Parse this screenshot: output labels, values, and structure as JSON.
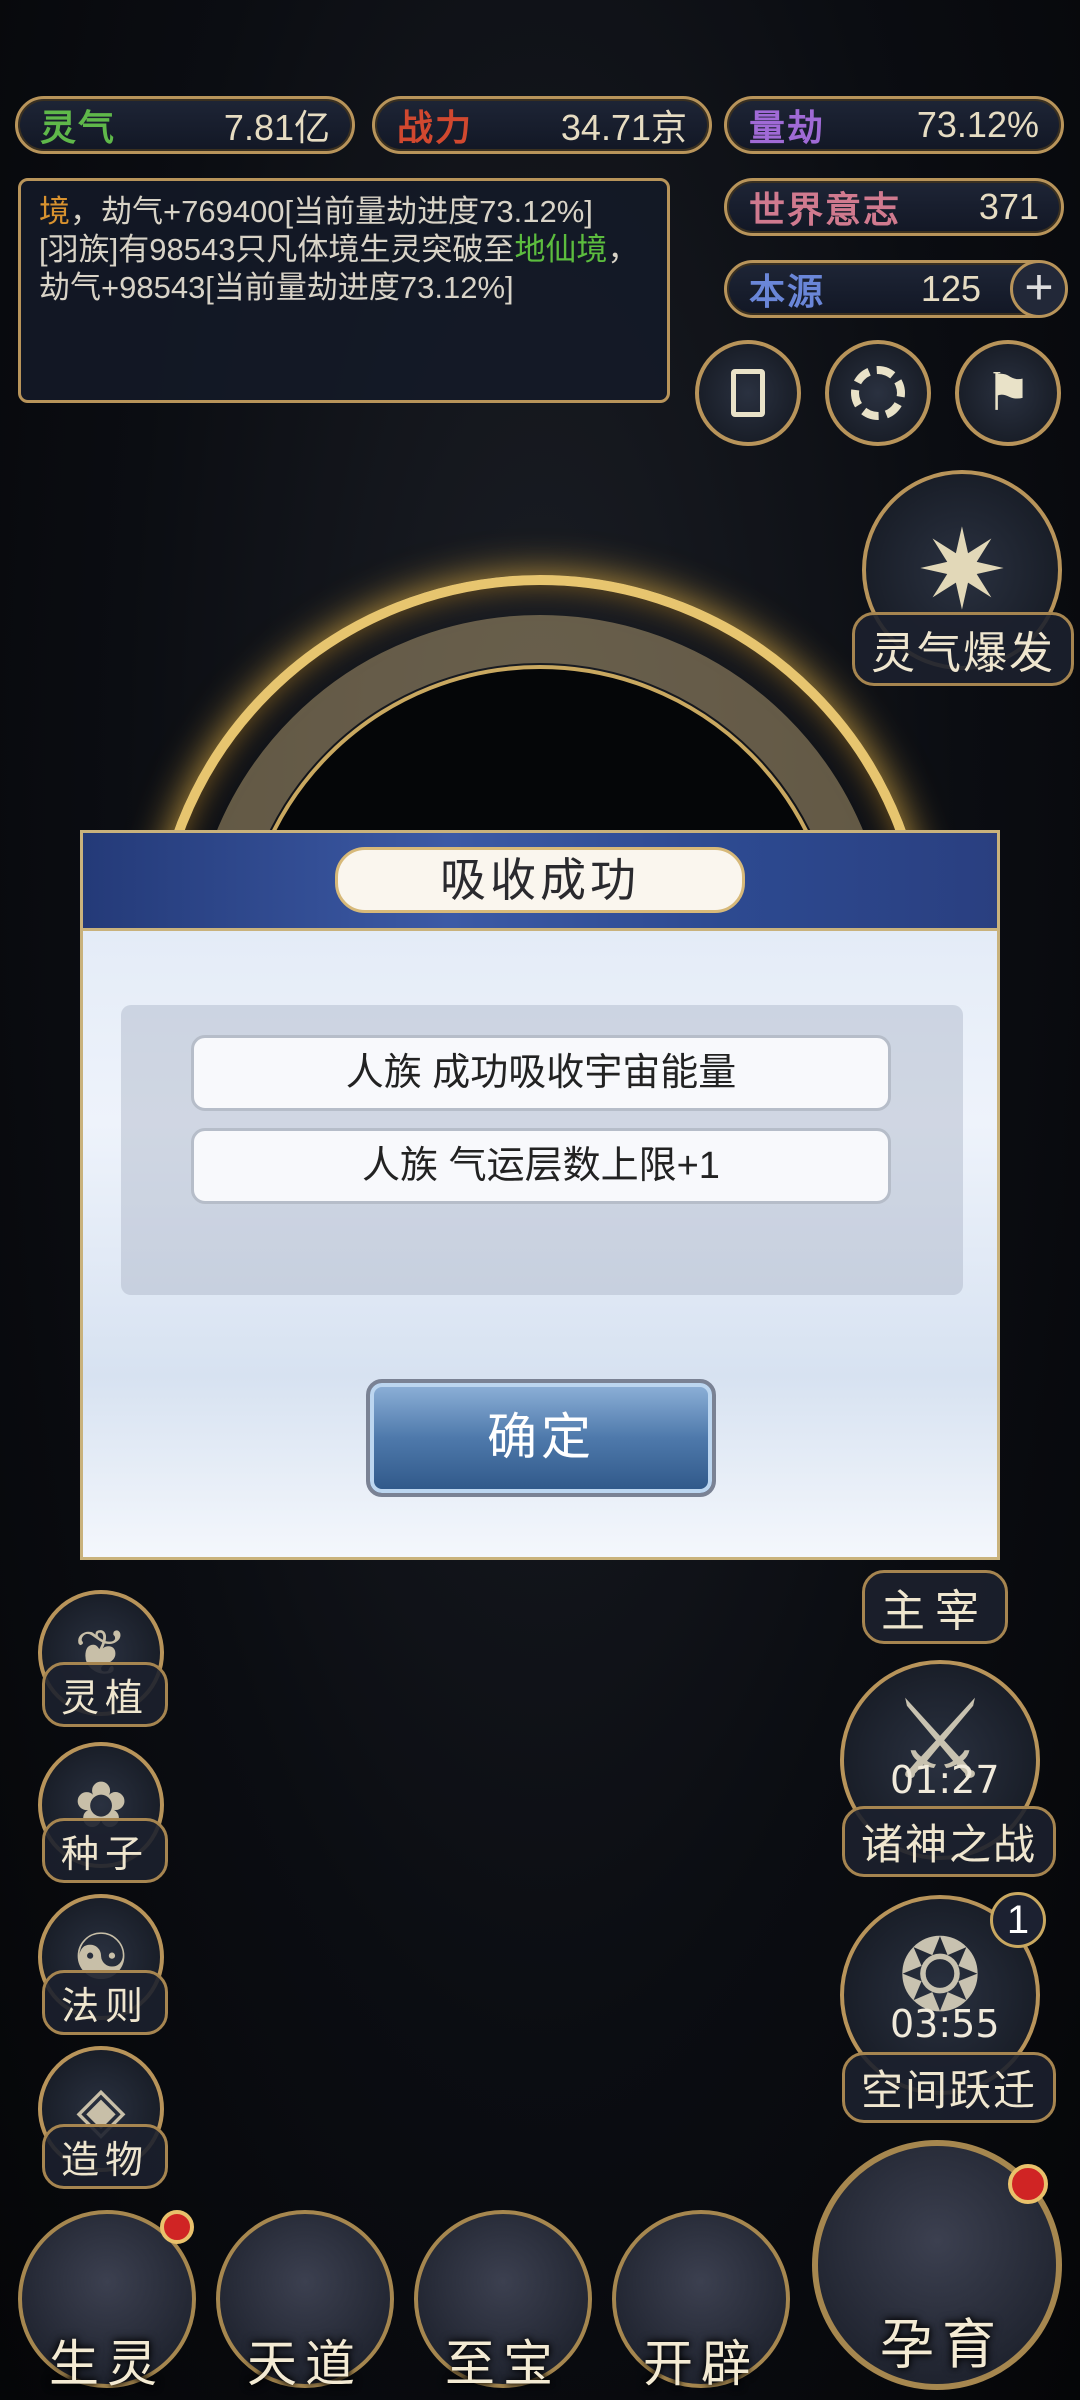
{
  "resources": {
    "lingqi": {
      "label": "灵气",
      "value": "7.81亿",
      "color": "#5fb84a"
    },
    "zhanli": {
      "label": "战力",
      "value": "34.71京",
      "color": "#d1482f"
    },
    "liangjie": {
      "label": "量劫",
      "value": "73.12%",
      "color": "#a06ad6"
    },
    "shijieyizhi": {
      "label": "世界意志",
      "value": "371",
      "color": "#d07a8f"
    },
    "benyuan": {
      "label": "本源",
      "value": "125",
      "color": "#6a86d8"
    }
  },
  "log": {
    "line1_highlight": "境",
    "line1_text": "，劫气+769400[当前量劫进度73.12%]",
    "line2_text": "[羽族]有98543只凡体境生灵突破至",
    "line2_highlight": "地仙境",
    "line2_tail": "，劫气+98543[当前量劫进度73.12%]"
  },
  "left_menu": [
    {
      "label": "灵植"
    },
    {
      "label": "种子"
    },
    {
      "label": "法则"
    },
    {
      "label": "造物"
    }
  ],
  "right_menu": {
    "burst": "灵气爆发",
    "zhuzai": "主宰",
    "battle": {
      "label": "诸神之战",
      "timer": "01:27"
    },
    "leap": {
      "label": "空间跃迁",
      "timer": "03:55",
      "badge": "1"
    }
  },
  "dialog": {
    "title": "吸收成功",
    "lines": [
      "人族 成功吸收宇宙能量",
      "人族 气运层数上限+1"
    ],
    "ok": "确定"
  },
  "bottom_nav": [
    {
      "label": "生灵"
    },
    {
      "label": "天道"
    },
    {
      "label": "至宝"
    },
    {
      "label": "开辟"
    },
    {
      "label": "孕育"
    }
  ],
  "colors": {
    "gold": "#b8945a",
    "dialog_header": "#2d4a91",
    "notify_red": "#d02424"
  }
}
